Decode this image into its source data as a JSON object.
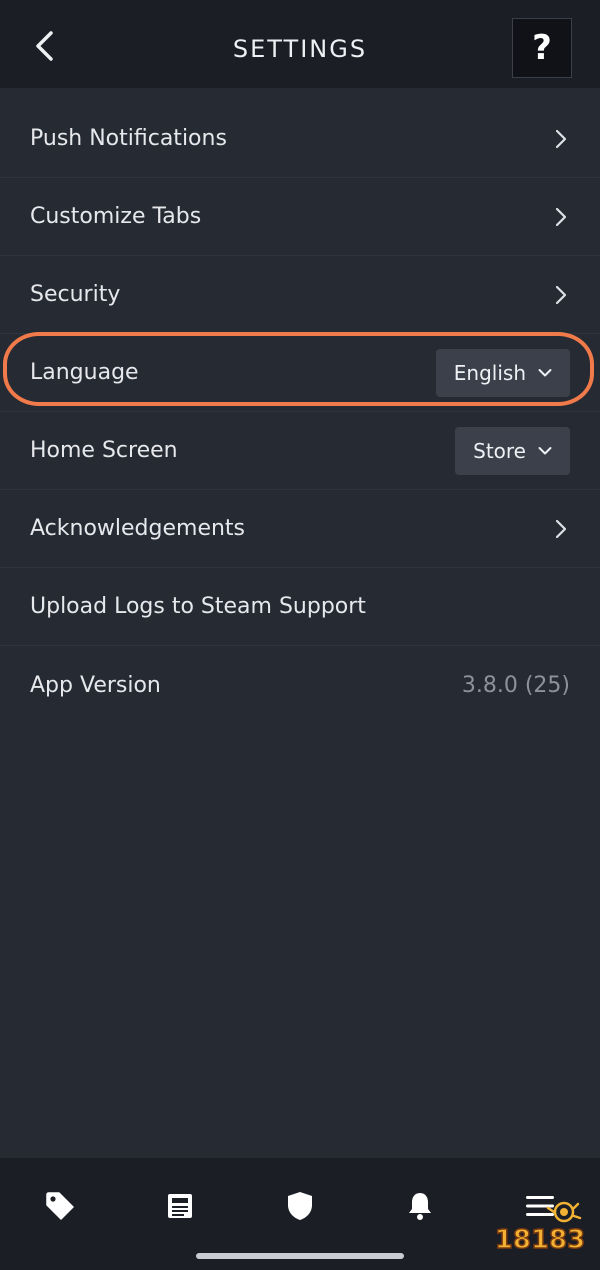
{
  "header": {
    "title": "SETTINGS",
    "back_icon": "chevron-left-icon",
    "help_label": "?"
  },
  "settings": {
    "push_notifications": "Push Notifications",
    "customize_tabs": "Customize Tabs",
    "security": "Security",
    "language": {
      "label": "Language",
      "value": "English"
    },
    "home_screen": {
      "label": "Home Screen",
      "value": "Store"
    },
    "acknowledgements": "Acknowledgements",
    "upload_logs": "Upload Logs to Steam Support",
    "app_version": {
      "label": "App Version",
      "value": "3.8.0 (25)"
    }
  },
  "bottom_nav": {
    "items": [
      "tag-icon",
      "news-icon",
      "shield-icon",
      "bell-icon",
      "menu-icon"
    ]
  },
  "watermark": {
    "text": "18183"
  },
  "colors": {
    "background": "#262a33",
    "header": "#1b1e24",
    "highlight": "#f07a4a",
    "dropdown": "#3b404b"
  }
}
